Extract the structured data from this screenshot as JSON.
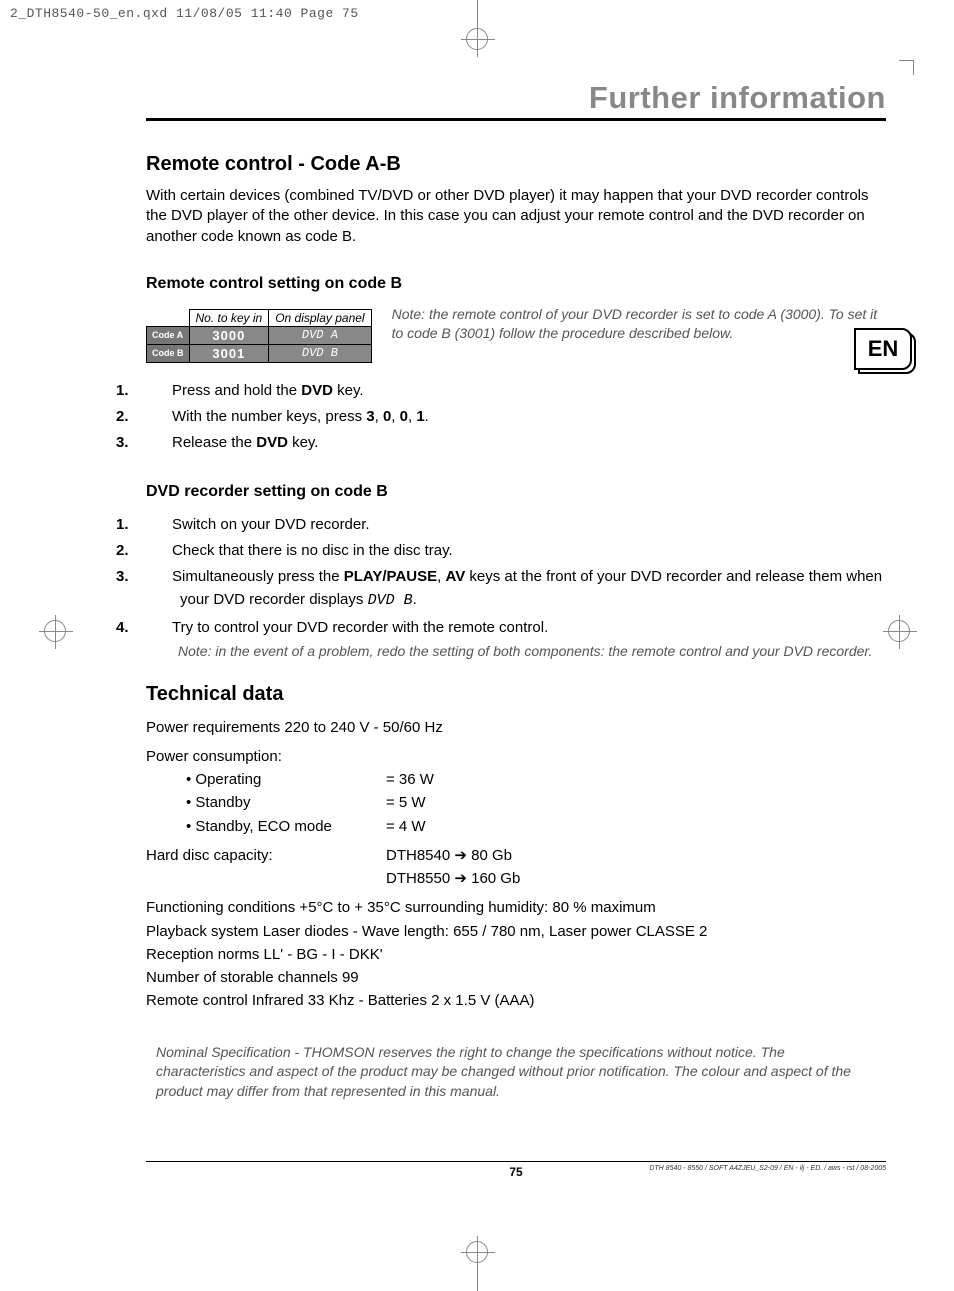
{
  "cropHeader": "2_DTH8540-50_en.qxd  11/08/05  11:40  Page 75",
  "chapterTitle": "Further information",
  "langBadge": "EN",
  "h1": "Remote control - Code A-B",
  "intro": "With certain devices (combined TV/DVD or other DVD player) it may happen that your DVD recorder controls the DVD player of the other device. In this case you can adjust your remote control and the DVD recorder on another code known as code B.",
  "h2a": "Remote control setting on code B",
  "codeTable": {
    "headers": [
      "No. to key in",
      "On display panel"
    ],
    "rows": [
      {
        "label": "Code A",
        "keyin": "3000",
        "display": "DVD A"
      },
      {
        "label": "Code B",
        "keyin": "3001",
        "display": "DVD B"
      }
    ]
  },
  "noteA": "Note: the remote control of your DVD recorder is set to code A (3000). To set it to code B (3001) follow the procedure described below.",
  "stepsA": {
    "s1": {
      "n": "1.",
      "pre": "Press and hold the ",
      "b": "DVD",
      "post": " key."
    },
    "s2": {
      "n": "2.",
      "pre": "With the number keys, press ",
      "b1": "3",
      "sep": ", ",
      "b2": "0",
      "b3": "0",
      "b4": "1",
      "post": "."
    },
    "s3": {
      "n": "3.",
      "pre": "Release the ",
      "b": "DVD",
      "post": " key."
    }
  },
  "h2b": "DVD recorder setting on code B",
  "stepsB": {
    "s1": {
      "n": "1.",
      "t": "Switch on your DVD recorder."
    },
    "s2": {
      "n": "2.",
      "t": "Check that there is no disc in the disc tray."
    },
    "s3": {
      "n": "3.",
      "pre": "Simultaneously press the ",
      "b1": "PLAY/PAUSE",
      "mid": ", ",
      "b2": "AV",
      "post": " keys at the front of your DVD recorder and release them when your DVD recorder displays ",
      "seg": "DVD B",
      "end": "."
    },
    "s4": {
      "n": "4.",
      "t": "Try to control your DVD recorder with the remote control."
    }
  },
  "noteB": "Note: in the event of a problem, redo the setting of both components: the remote control and your DVD recorder.",
  "h1c": "Technical data",
  "tech": {
    "power_req": "Power requirements 220 to 240 V - 50/60 Hz",
    "consumption_label": "Power consumption:",
    "operating": {
      "l": "• Operating",
      "v": "= 36 W"
    },
    "standby": {
      "l": "• Standby",
      "v": "= 5 W"
    },
    "eco": {
      "l": "• Standby, ECO mode",
      "v": "= 4 W"
    },
    "hdd_label": "Hard disc capacity:",
    "hdd1": "DTH8540 ➔ 80 Gb",
    "hdd2": "DTH8550 ➔ 160 Gb",
    "cond": "Functioning conditions +5°C to + 35°C surrounding humidity: 80 % maximum",
    "laser": "Playback system Laser diodes - Wave length: 655 / 780 nm, Laser power CLASSE 2",
    "norms": "Reception norms LL' - BG - I - DKK'",
    "channels": "Number of storable channels 99",
    "remote": "Remote control Infrared 33 Khz - Batteries 2 x 1.5 V (AAA)"
  },
  "disclaimer": "Nominal Specification - THOMSON reserves the right to change the specifications without notice. The characteristics and aspect of the product may be changed without prior notification. The colour and aspect of the product may differ from that represented in this manual.",
  "pageNum": "75",
  "docRef": "DTH 8540 - 8550 / SOFT A4ZJEU_S2-09 / EN - ilj - ED. / aws - rst / 08-2005"
}
